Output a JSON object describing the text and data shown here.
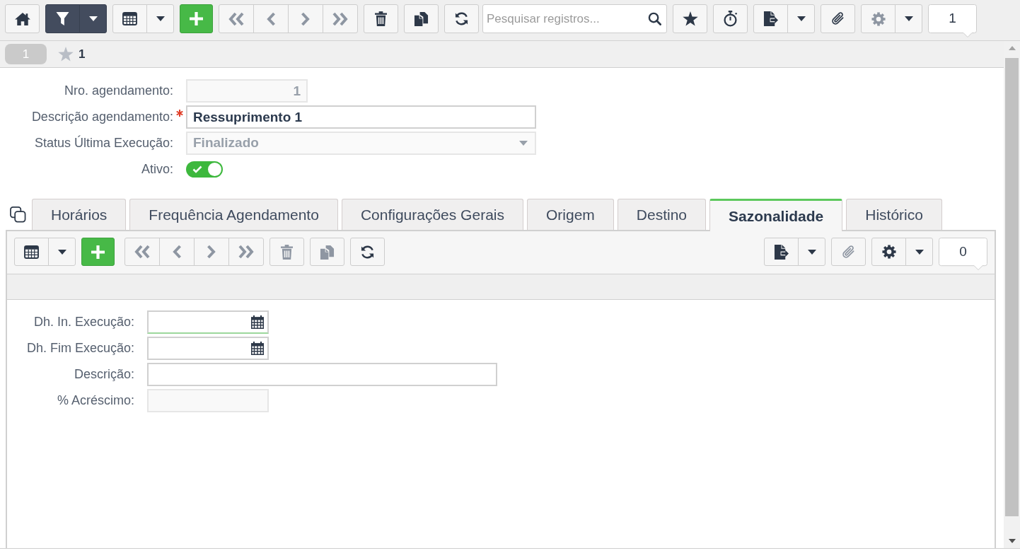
{
  "toolbar": {
    "filter": {
      "active": true
    },
    "navigation": {
      "disabled": true
    },
    "delete": {
      "disabled": false
    },
    "copy": {
      "disabled": false
    },
    "search": {
      "placeholder": "Pesquisar registros..."
    },
    "attach": {
      "disabled": false
    },
    "settings": {
      "disabled": true
    },
    "counter": "1"
  },
  "record_bar": {
    "tab": "1",
    "favorite": {
      "starred": false
    },
    "title": "1"
  },
  "form": {
    "fields": [
      {
        "kind": "number",
        "label": "Nro. agendamento:",
        "value": "1",
        "disabled": true
      },
      {
        "kind": "text",
        "label": "Descrição agendamento:",
        "value": "Ressuprimento 1",
        "disabled": false,
        "required": true
      },
      {
        "kind": "select",
        "label": "Status Última Execução:",
        "value": "Finalizado",
        "disabled": true
      },
      {
        "kind": "toggle",
        "label": "Ativo:",
        "on": true,
        "disabled": false
      }
    ]
  },
  "tabs": [
    {
      "label": "Horários",
      "selected": false
    },
    {
      "label": "Frequência Agendamento",
      "selected": false
    },
    {
      "label": "Configurações Gerais",
      "selected": false
    },
    {
      "label": "Origem",
      "selected": false
    },
    {
      "label": "Destino",
      "selected": false
    },
    {
      "label": "Sazonalidade",
      "selected": true
    },
    {
      "label": "Histórico",
      "selected": false
    }
  ],
  "tab_panel": {
    "toolbar": {
      "navigation": {
        "disabled": true
      },
      "delete": {
        "disabled": true
      },
      "copy": {
        "disabled": true
      },
      "attach": {
        "disabled": true
      },
      "settings": {
        "disabled": false
      },
      "counter": "0"
    },
    "fields": [
      {
        "kind": "date",
        "label": "Dh. In. Execução:",
        "disabled": false,
        "focused": true
      },
      {
        "kind": "date",
        "label": "Dh. Fim Execução:",
        "disabled": false,
        "focused": false
      },
      {
        "kind": "text",
        "label": "Descrição:",
        "disabled": false,
        "focused": false
      },
      {
        "kind": "number",
        "label": "% Acréscimo:",
        "disabled": true,
        "focused": false
      }
    ]
  }
}
